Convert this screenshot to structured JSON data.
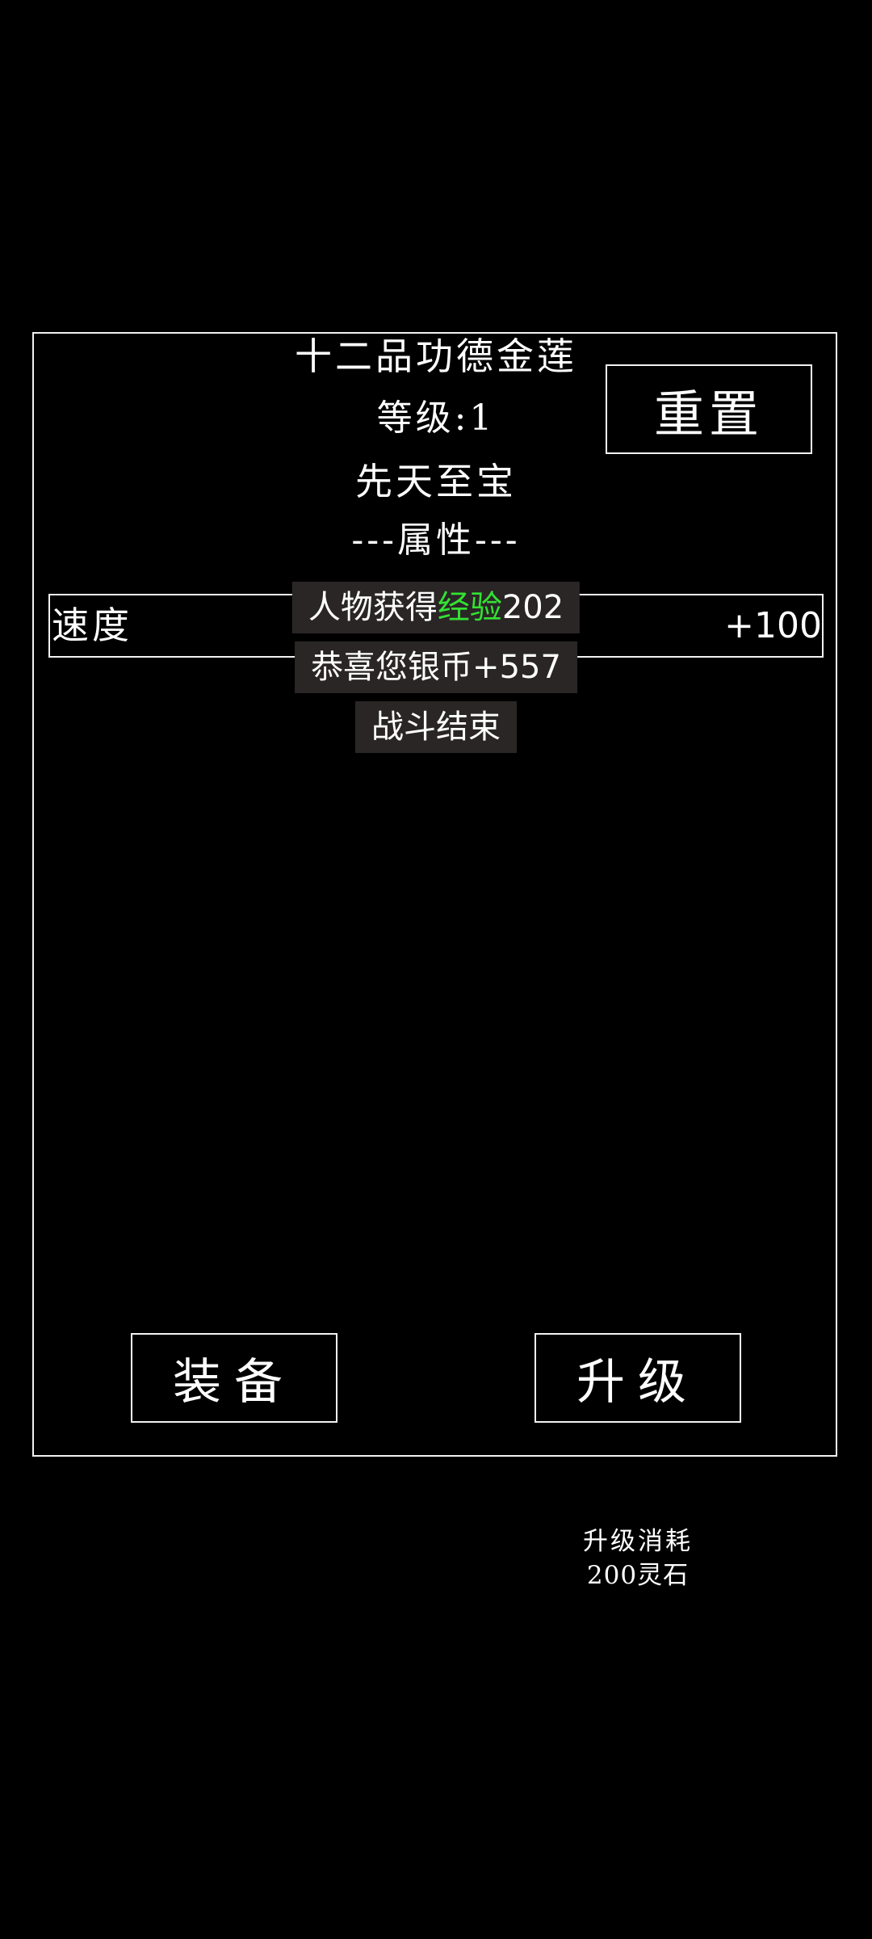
{
  "item": {
    "name": "十二品功德金莲",
    "level_label": "等级:1",
    "grade": "先天至宝",
    "attributes_header": "---属性---"
  },
  "buttons": {
    "reset": "重置",
    "equip": "装备",
    "upgrade": "升级"
  },
  "attributes": [
    {
      "name": "速度",
      "value": "+100"
    }
  ],
  "toasts": {
    "exp_prefix": "人物获得",
    "exp_highlight": "经验",
    "exp_amount": "202",
    "silver": "恭喜您银币+557",
    "battle_end": "战斗结束"
  },
  "upgrade_cost": {
    "line1": "升级消耗",
    "line2": "200灵石"
  },
  "colors": {
    "background": "#000000",
    "border": "#f2f2f2",
    "toast_bg": "#2a2626",
    "highlight": "#33e233"
  }
}
